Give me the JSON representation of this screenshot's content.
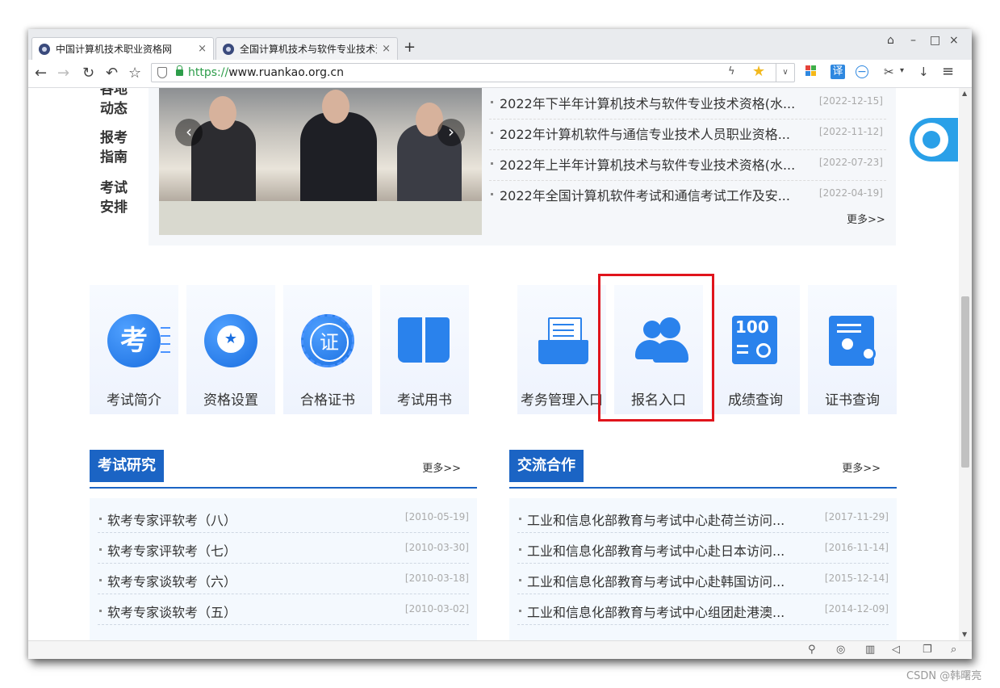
{
  "browser": {
    "tabs": [
      {
        "label": "中国计算机技术职业资格网",
        "close": "×"
      },
      {
        "label": "全国计算机技术与软件专业技术资",
        "close": "×"
      }
    ],
    "new_tab": "+",
    "window_controls": {
      "skin": "⌂",
      "minimize": "–",
      "maximize": "□",
      "close": "×"
    },
    "nav": {
      "back": "←",
      "forward": "→",
      "reload": "↻",
      "undo": "↶",
      "star": "☆"
    },
    "url": {
      "scheme": "https://",
      "host": "www.ruankao.org.cn"
    },
    "toolbar": {
      "translate": "译",
      "minus": "−",
      "scissors": "✂",
      "dropdown": "▾",
      "download": "↓",
      "menu": "≡",
      "bolt": "ϟ",
      "fav": "★",
      "chevron": "∨"
    }
  },
  "page": {
    "side_links": [
      "各地动态",
      "报考指南",
      "考试安排"
    ],
    "news": [
      {
        "title": "2022年下半年计算机技术与软件专业技术资格(水...",
        "date": "[2022-12-15]"
      },
      {
        "title": "2022年计算机软件与通信专业技术人员职业资格...",
        "date": "[2022-11-12]"
      },
      {
        "title": "2022年上半年计算机技术与软件专业技术资格(水...",
        "date": "[2022-07-23]"
      },
      {
        "title": "2022年全国计算机软件考试和通信考试工作及安...",
        "date": "[2022-04-19]"
      }
    ],
    "news_more": "更多>>",
    "slider_prev": "‹",
    "slider_next": "›",
    "tiles_left": [
      {
        "label": "考试简介",
        "glyph": "考",
        "icon": "kao-icon"
      },
      {
        "label": "资格设置",
        "glyph": "★",
        "icon": "medal-icon"
      },
      {
        "label": "合格证书",
        "glyph": "证",
        "icon": "certificate-seal-icon"
      },
      {
        "label": "考试用书",
        "glyph": "",
        "icon": "book-icon"
      }
    ],
    "tiles_right": [
      {
        "label": "考务管理入口",
        "icon": "folder-icon"
      },
      {
        "label": "报名入口",
        "icon": "users-icon"
      },
      {
        "label": "成绩查询",
        "glyph": "100",
        "icon": "score-search-icon"
      },
      {
        "label": "证书查询",
        "icon": "certificate-search-icon"
      }
    ],
    "research": {
      "title": "考试研究",
      "more": "更多>>",
      "items": [
        {
          "title": "软考专家评软考（八）",
          "date": "[2010-05-19]"
        },
        {
          "title": "软考专家评软考（七）",
          "date": "[2010-03-30]"
        },
        {
          "title": "软考专家谈软考（六）",
          "date": "[2010-03-18]"
        },
        {
          "title": "软考专家谈软考（五）",
          "date": "[2010-03-02]"
        }
      ]
    },
    "cooperation": {
      "title": "交流合作",
      "more": "更多>>",
      "items": [
        {
          "title": "工业和信息化部教育与考试中心赴荷兰访问...",
          "date": "[2017-11-29]"
        },
        {
          "title": "工业和信息化部教育与考试中心赴日本访问...",
          "date": "[2016-11-14]"
        },
        {
          "title": "工业和信息化部教育与考试中心赴韩国访问...",
          "date": "[2015-12-14]"
        },
        {
          "title": "工业和信息化部教育与考试中心组团赴港澳...",
          "date": "[2014-12-09]"
        }
      ]
    }
  },
  "watermark": "CSDN @韩曙亮",
  "colors": {
    "accent": "#1b64c4",
    "highlight": "#e0141c",
    "url_green": "#2d9d4a"
  }
}
